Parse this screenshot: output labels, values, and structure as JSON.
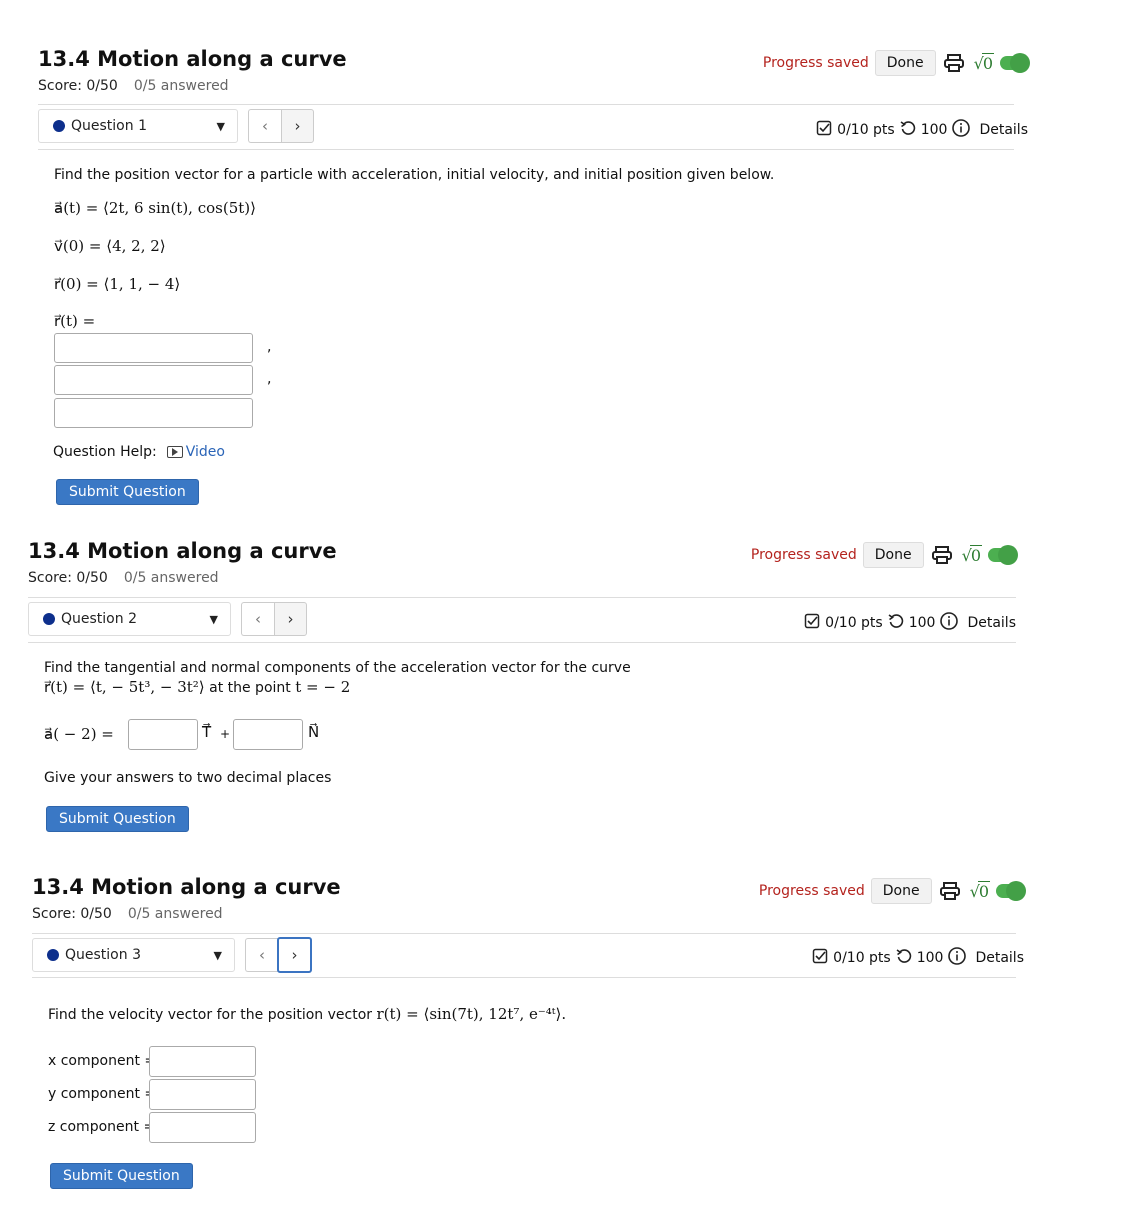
{
  "header": {
    "title": "13.4 Motion along a curve",
    "score": "Score: 0/50",
    "answered": "0/5 answered",
    "progress": "Progress saved",
    "done": "Done"
  },
  "meta": {
    "pts": "0/10 pts",
    "retries": "100",
    "details": "Details"
  },
  "submit_label": "Submit Question",
  "colors": {
    "accent": "#3a78c5",
    "saved": "#b4231e",
    "toggle": "#4caf50",
    "bullet": "#0d2f8c"
  },
  "q1": {
    "selector": "Question 1",
    "prompt": "Find the position vector for a particle with acceleration, initial velocity, and initial position given below.",
    "accel": "a⃗(t) = ⟨2t, 6 sin(t), cos(5t)⟩",
    "vel0": "v⃗(0) = ⟨4, 2, 2⟩",
    "pos0": "r⃗(0) = ⟨1, 1,  − 4⟩",
    "answer_label": "r⃗(t) =",
    "help_label": "Question Help:",
    "video": "Video"
  },
  "q2": {
    "selector": "Question 2",
    "prompt": "Find the tangential and normal components of the acceleration vector for the curve",
    "curve": "r⃗(t) = ⟨t,  − 5t³,  − 3t²⟩",
    "at_point": "at the point",
    "point": "t =  − 2",
    "lhs": "a⃗( − 2) =",
    "T": "T⃗",
    "plus": "+",
    "N": "N⃗",
    "note": "Give your answers to two decimal places"
  },
  "q3": {
    "selector": "Question 3",
    "prompt": "Find the velocity vector for the position vector",
    "expr": "r(t) = ⟨sin(7t), 12t⁷, e⁻⁴ᵗ⟩.",
    "x_label": "x component =",
    "y_label": "y component =",
    "z_label": "z component ="
  },
  "icons": [
    "print-icon",
    "sqrt-icon",
    "toggle-icon",
    "checkbox-icon",
    "retry-icon",
    "info-icon",
    "video-icon"
  ]
}
